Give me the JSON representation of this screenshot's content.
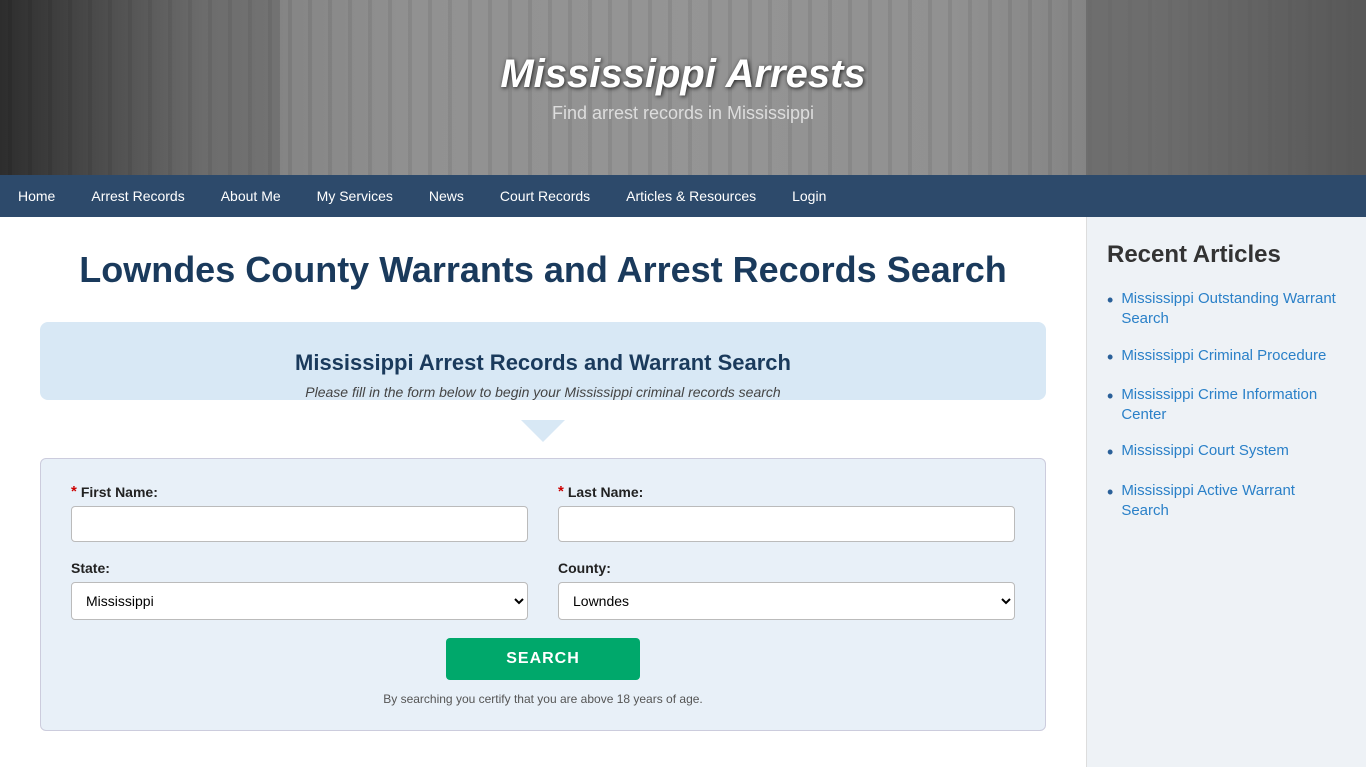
{
  "hero": {
    "title": "Mississippi Arrests",
    "subtitle": "Find arrest records in Mississippi"
  },
  "nav": {
    "items": [
      {
        "id": "home",
        "label": "Home",
        "active": false
      },
      {
        "id": "arrest-records",
        "label": "Arrest Records",
        "active": false
      },
      {
        "id": "about-me",
        "label": "About Me",
        "active": false
      },
      {
        "id": "my-services",
        "label": "My Services",
        "active": false
      },
      {
        "id": "news",
        "label": "News",
        "active": false
      },
      {
        "id": "court-records",
        "label": "Court Records",
        "active": false
      },
      {
        "id": "articles-resources",
        "label": "Articles & Resources",
        "active": false
      },
      {
        "id": "login",
        "label": "Login",
        "active": false
      }
    ]
  },
  "main": {
    "page_title": "Lowndes County Warrants and Arrest Records Search",
    "search_card": {
      "title": "Mississippi Arrest Records and Warrant Search",
      "subtitle": "Please fill in the form below to begin your Mississippi criminal records search"
    },
    "form": {
      "first_name_label": "First Name:",
      "last_name_label": "Last Name:",
      "state_label": "State:",
      "county_label": "County:",
      "state_value": "Mississippi",
      "county_value": "Lowndes",
      "search_button": "SEARCH",
      "disclaimer": "By searching you certify that you are above 18 years of age."
    }
  },
  "sidebar": {
    "title": "Recent Articles",
    "articles": [
      {
        "id": "outstanding-warrant",
        "label": "Mississippi Outstanding Warrant Search"
      },
      {
        "id": "criminal-procedure",
        "label": "Mississippi Criminal Procedure"
      },
      {
        "id": "crime-information-center",
        "label": "Mississippi Crime Information Center"
      },
      {
        "id": "court-system",
        "label": "Mississippi Court System"
      },
      {
        "id": "active-warrant",
        "label": "Mississippi Active Warrant Search"
      }
    ]
  }
}
